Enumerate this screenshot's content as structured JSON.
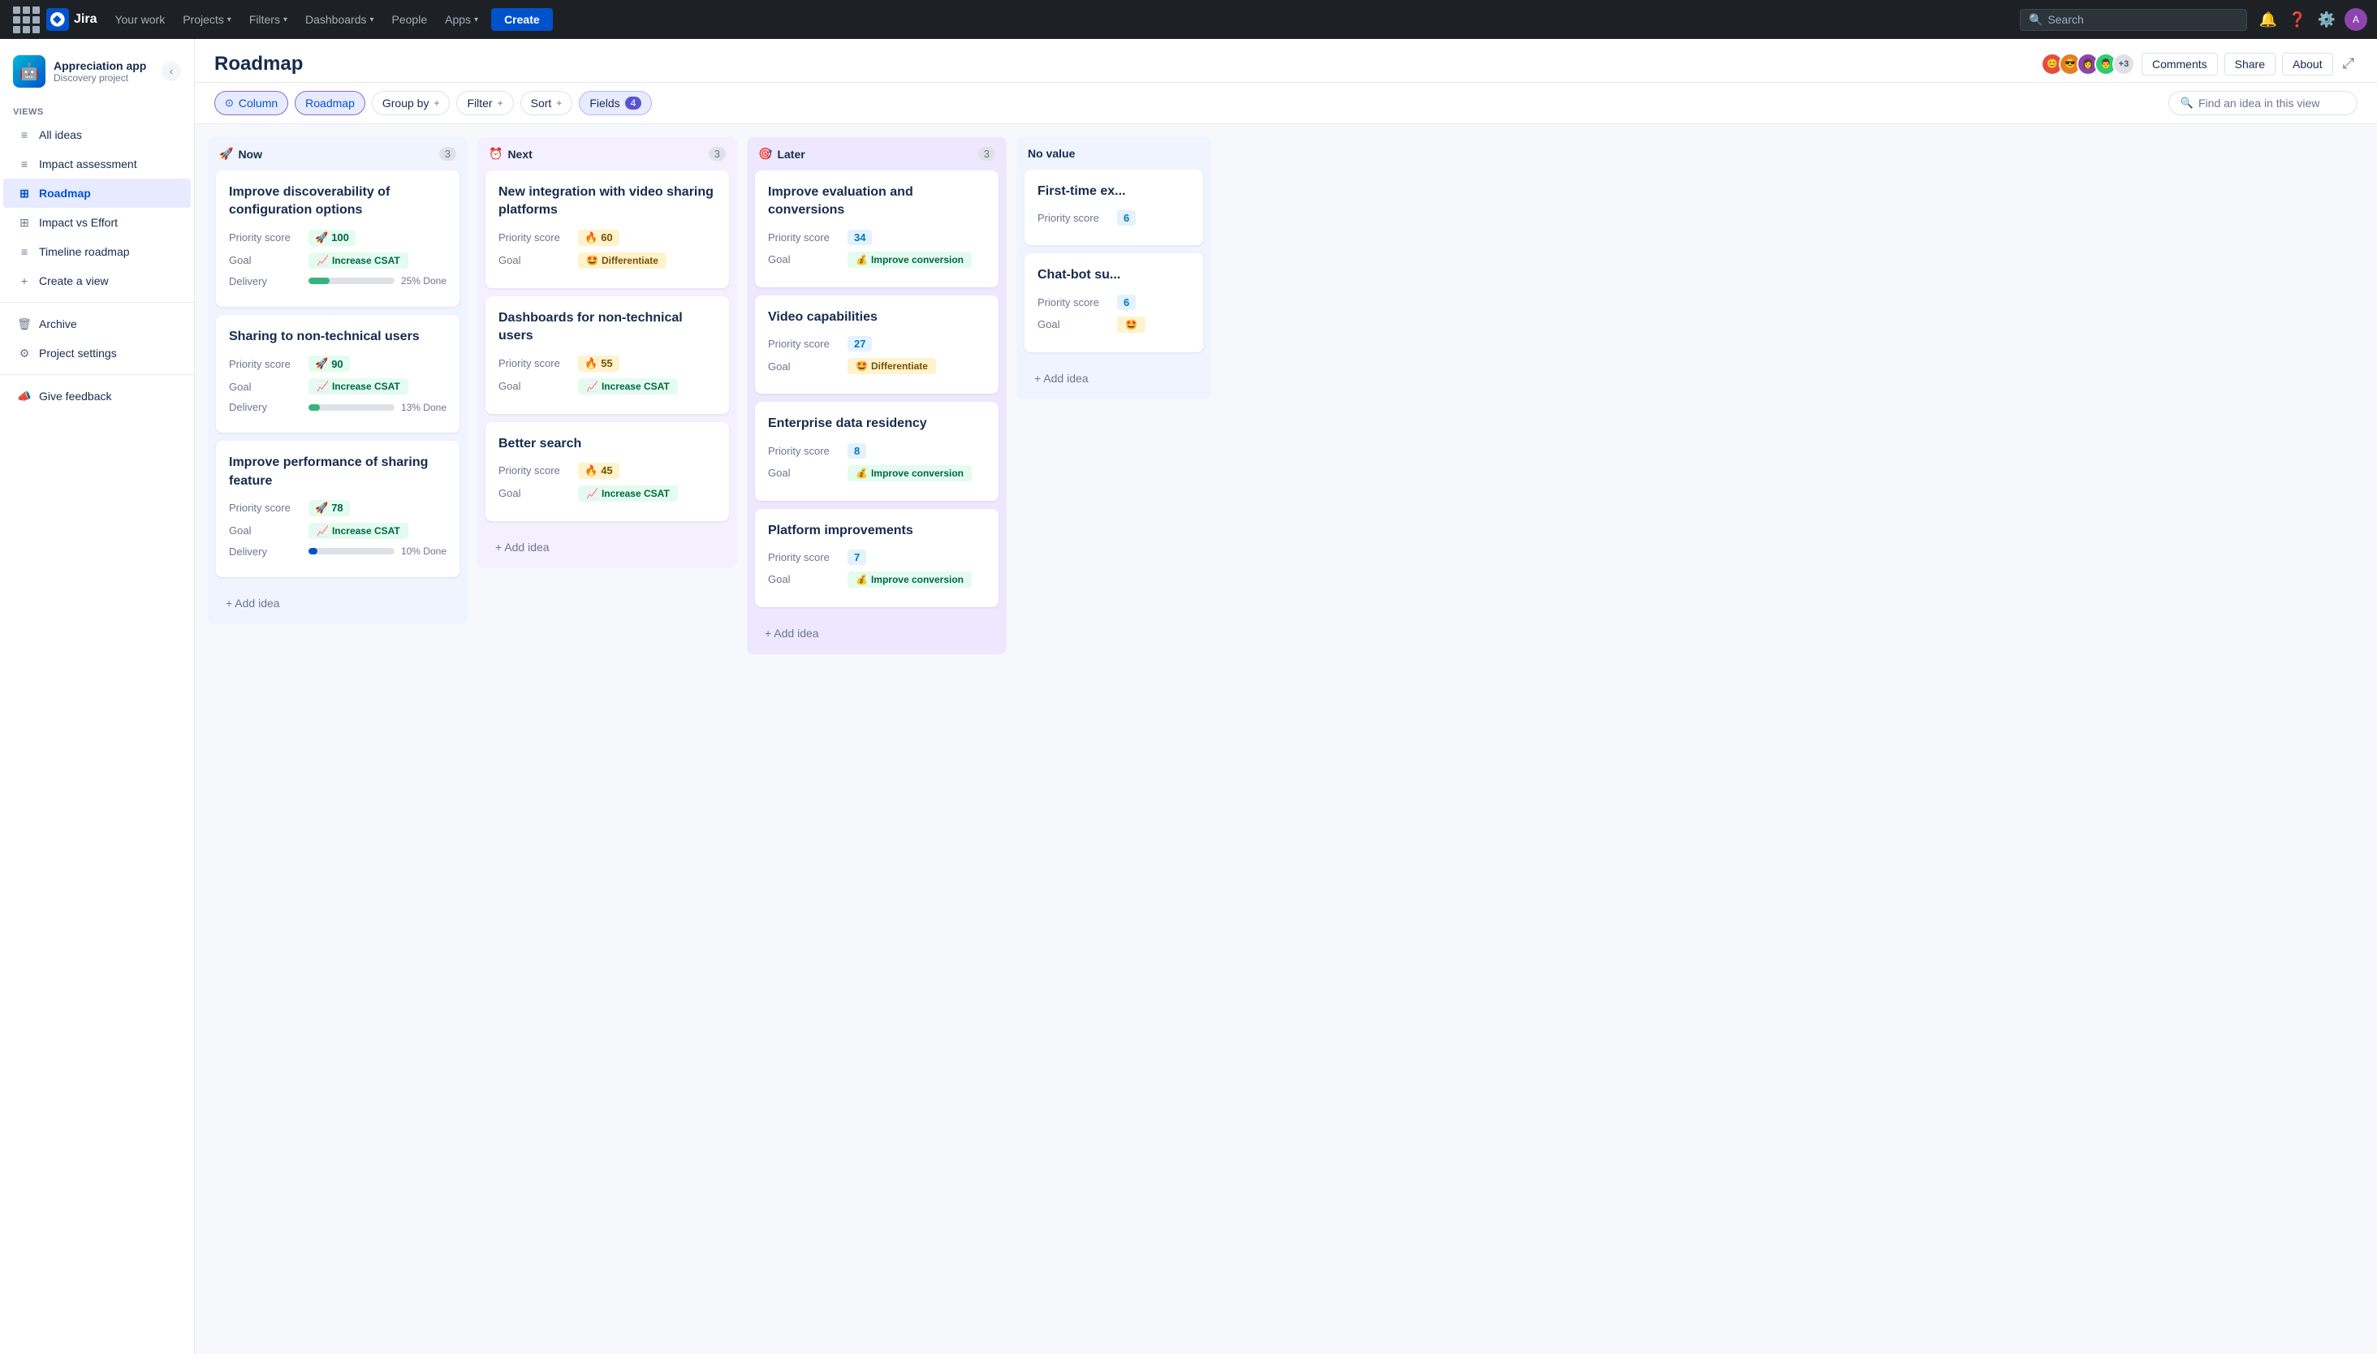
{
  "topnav": {
    "logo_text": "Jira",
    "nav_items": [
      {
        "label": "Your work"
      },
      {
        "label": "Projects",
        "has_chevron": true
      },
      {
        "label": "Filters",
        "has_chevron": true
      },
      {
        "label": "Dashboards",
        "has_chevron": true
      },
      {
        "label": "People"
      },
      {
        "label": "Apps",
        "has_chevron": true
      }
    ],
    "create_label": "Create",
    "search_placeholder": "Search"
  },
  "sidebar": {
    "project_name": "Appreciation app",
    "project_sub": "Discovery project",
    "views_label": "VIEWS",
    "views_add": "+",
    "nav_items": [
      {
        "label": "All ideas",
        "icon": "≡",
        "active": false
      },
      {
        "label": "Impact assessment",
        "icon": "≡",
        "active": false
      },
      {
        "label": "Roadmap",
        "icon": "⊞",
        "active": true
      },
      {
        "label": "Impact vs Effort",
        "icon": "⊞",
        "active": false
      },
      {
        "label": "Timeline roadmap",
        "icon": "≡",
        "active": false
      }
    ],
    "create_view": "Create a view",
    "archive": "Archive",
    "project_settings": "Project settings",
    "give_feedback": "Give feedback"
  },
  "page": {
    "title": "Roadmap",
    "avatars": [
      "#e74c3c",
      "#e67e22",
      "#8e44ad",
      "#2ecc71"
    ],
    "avatar_count": "+3",
    "comments_label": "Comments",
    "share_label": "Share",
    "about_label": "About"
  },
  "toolbar": {
    "column_label": "Column",
    "column_icon": "⊙",
    "roadmap_label": "Roadmap",
    "groupby_label": "Group by",
    "filter_label": "Filter",
    "sort_label": "Sort",
    "fields_label": "Fields",
    "fields_count": "4",
    "search_placeholder": "Find an idea in this view"
  },
  "columns": [
    {
      "id": "now",
      "label": "Now",
      "emoji": "🚀",
      "count": 3,
      "color_class": "column-now",
      "cards": [
        {
          "title": "Improve discoverability of configuration options",
          "priority_score_label": "Priority score",
          "priority_score": "100",
          "score_emoji": "🚀",
          "score_class": "score-high",
          "goal_label": "Goal",
          "goal_text": "Increase CSAT",
          "goal_emoji": "📈",
          "goal_class": "goal-csat",
          "delivery_label": "Delivery",
          "progress": 25,
          "progress_text": "25% Done"
        },
        {
          "title": "Sharing to non-technical users",
          "priority_score_label": "Priority score",
          "priority_score": "90",
          "score_emoji": "🚀",
          "score_class": "score-high",
          "goal_label": "Goal",
          "goal_text": "Increase CSAT",
          "goal_emoji": "📈",
          "goal_class": "goal-csat",
          "delivery_label": "Delivery",
          "progress": 13,
          "progress_text": "13% Done"
        },
        {
          "title": "Improve performance of sharing feature",
          "priority_score_label": "Priority score",
          "priority_score": "78",
          "score_emoji": "🚀",
          "score_class": "score-high",
          "goal_label": "Goal",
          "goal_text": "Increase CSAT",
          "goal_emoji": "📈",
          "goal_class": "goal-csat",
          "delivery_label": "Delivery",
          "progress": 10,
          "progress_text": "10% Done"
        }
      ],
      "add_label": "+ Add idea"
    },
    {
      "id": "next",
      "label": "Next",
      "emoji": "⏰",
      "count": 3,
      "color_class": "column-next",
      "cards": [
        {
          "title": "New integration with video sharing platforms",
          "priority_score_label": "Priority score",
          "priority_score": "60",
          "score_emoji": "🔥",
          "score_class": "score-med",
          "goal_label": "Goal",
          "goal_text": "Differentiate",
          "goal_emoji": "🤩",
          "goal_class": "goal-diff",
          "has_delivery": false
        },
        {
          "title": "Dashboards for non-technical users",
          "priority_score_label": "Priority score",
          "priority_score": "55",
          "score_emoji": "🔥",
          "score_class": "score-med",
          "goal_label": "Goal",
          "goal_text": "Increase CSAT",
          "goal_emoji": "📈",
          "goal_class": "goal-csat",
          "has_delivery": false
        },
        {
          "title": "Better search",
          "priority_score_label": "Priority score",
          "priority_score": "45",
          "score_emoji": "🔥",
          "score_class": "score-med",
          "goal_label": "Goal",
          "goal_text": "Increase CSAT",
          "goal_emoji": "📈",
          "goal_class": "goal-csat",
          "has_delivery": false
        }
      ],
      "add_label": "+ Add idea"
    },
    {
      "id": "later",
      "label": "Later",
      "emoji": "🎯",
      "count": 3,
      "color_class": "column-later",
      "cards": [
        {
          "title": "Improve evaluation and conversions",
          "priority_score_label": "Priority score",
          "priority_score": "34",
          "score_emoji": "",
          "score_class": "score-low",
          "goal_label": "Goal",
          "goal_text": "Improve conversion",
          "goal_emoji": "💰",
          "goal_class": "goal-conv",
          "has_delivery": false
        },
        {
          "title": "Video capabilities",
          "priority_score_label": "Priority score",
          "priority_score": "27",
          "score_emoji": "",
          "score_class": "score-low",
          "goal_label": "Goal",
          "goal_text": "Differentiate",
          "goal_emoji": "🤩",
          "goal_class": "goal-diff",
          "has_delivery": false
        },
        {
          "title": "Enterprise data residency",
          "priority_score_label": "Priority score",
          "priority_score": "8",
          "score_emoji": "",
          "score_class": "score-low",
          "goal_label": "Goal",
          "goal_text": "Improve conversion",
          "goal_emoji": "💰",
          "goal_class": "goal-conv",
          "has_delivery": false
        },
        {
          "title": "Platform improvements",
          "priority_score_label": "Priority score",
          "priority_score": "7",
          "score_emoji": "",
          "score_class": "score-low",
          "goal_label": "Goal",
          "goal_text": "Improve conversion",
          "goal_emoji": "💰",
          "goal_class": "goal-conv",
          "has_delivery": false
        }
      ],
      "add_label": "+ Add idea"
    },
    {
      "id": "no-value",
      "label": "No value",
      "count": null,
      "color_class": "column-none",
      "cards": [
        {
          "title": "First-time ex...",
          "priority_score_label": "Priority score",
          "priority_score": "6",
          "score_class": "score-low",
          "has_delivery": false
        },
        {
          "title": "Chat-bot su...",
          "priority_score_label": "Priority score",
          "priority_score": "6",
          "score_class": "score-low",
          "goal_label": "Goal",
          "goal_emoji": "🤩",
          "goal_text": "",
          "has_delivery": false
        }
      ],
      "add_label": "+ Add idea"
    }
  ]
}
